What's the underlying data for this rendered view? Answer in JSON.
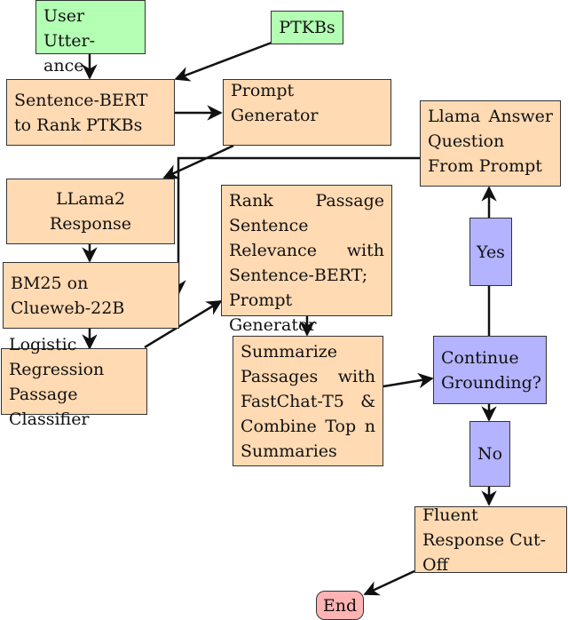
{
  "diagram": {
    "colors": {
      "input": "#b3ffb3",
      "process": "#ffdab3",
      "decision": "#b3b3ff",
      "terminal": "#ffb3b3"
    },
    "nodes": {
      "user_utterance": "User Utter-ance",
      "ptkbs": "PTKBs",
      "sbert_rank": "Sentence-BERT to Rank PTKBs",
      "prompt_generator": "Prompt Generator",
      "llama_answer": "Llama Answer Question From Prompt",
      "llama2_response": "LLama2 Response",
      "bm25": "BM25 on Clueweb-22B",
      "logistic_regression": "Logistic Regression Passage Classifier",
      "rank_passage": "Rank Passage Sentence Relevance with Sentence-BERT; Prompt Generator",
      "summarize": "Summarize Passages with FastChat-T5 & Combine Top n Summaries",
      "continue_grounding": "Continue Grounding?",
      "yes": "Yes",
      "no": "No",
      "fluent_cutoff": "Fluent Response Cut-Off",
      "end": "End"
    },
    "edges": [
      [
        "user_utterance",
        "sbert_rank"
      ],
      [
        "ptkbs",
        "sbert_rank"
      ],
      [
        "sbert_rank",
        "prompt_generator"
      ],
      [
        "prompt_generator",
        "llama2_response"
      ],
      [
        "llama2_response",
        "bm25"
      ],
      [
        "llama_answer",
        "bm25"
      ],
      [
        "bm25",
        "logistic_regression"
      ],
      [
        "logistic_regression",
        "rank_passage"
      ],
      [
        "rank_passage",
        "summarize"
      ],
      [
        "summarize",
        "continue_grounding"
      ],
      [
        "continue_grounding",
        "no"
      ],
      [
        "no",
        "fluent_cutoff"
      ],
      [
        "continue_grounding",
        "yes"
      ],
      [
        "yes",
        "llama_answer"
      ],
      [
        "fluent_cutoff",
        "end"
      ]
    ]
  }
}
